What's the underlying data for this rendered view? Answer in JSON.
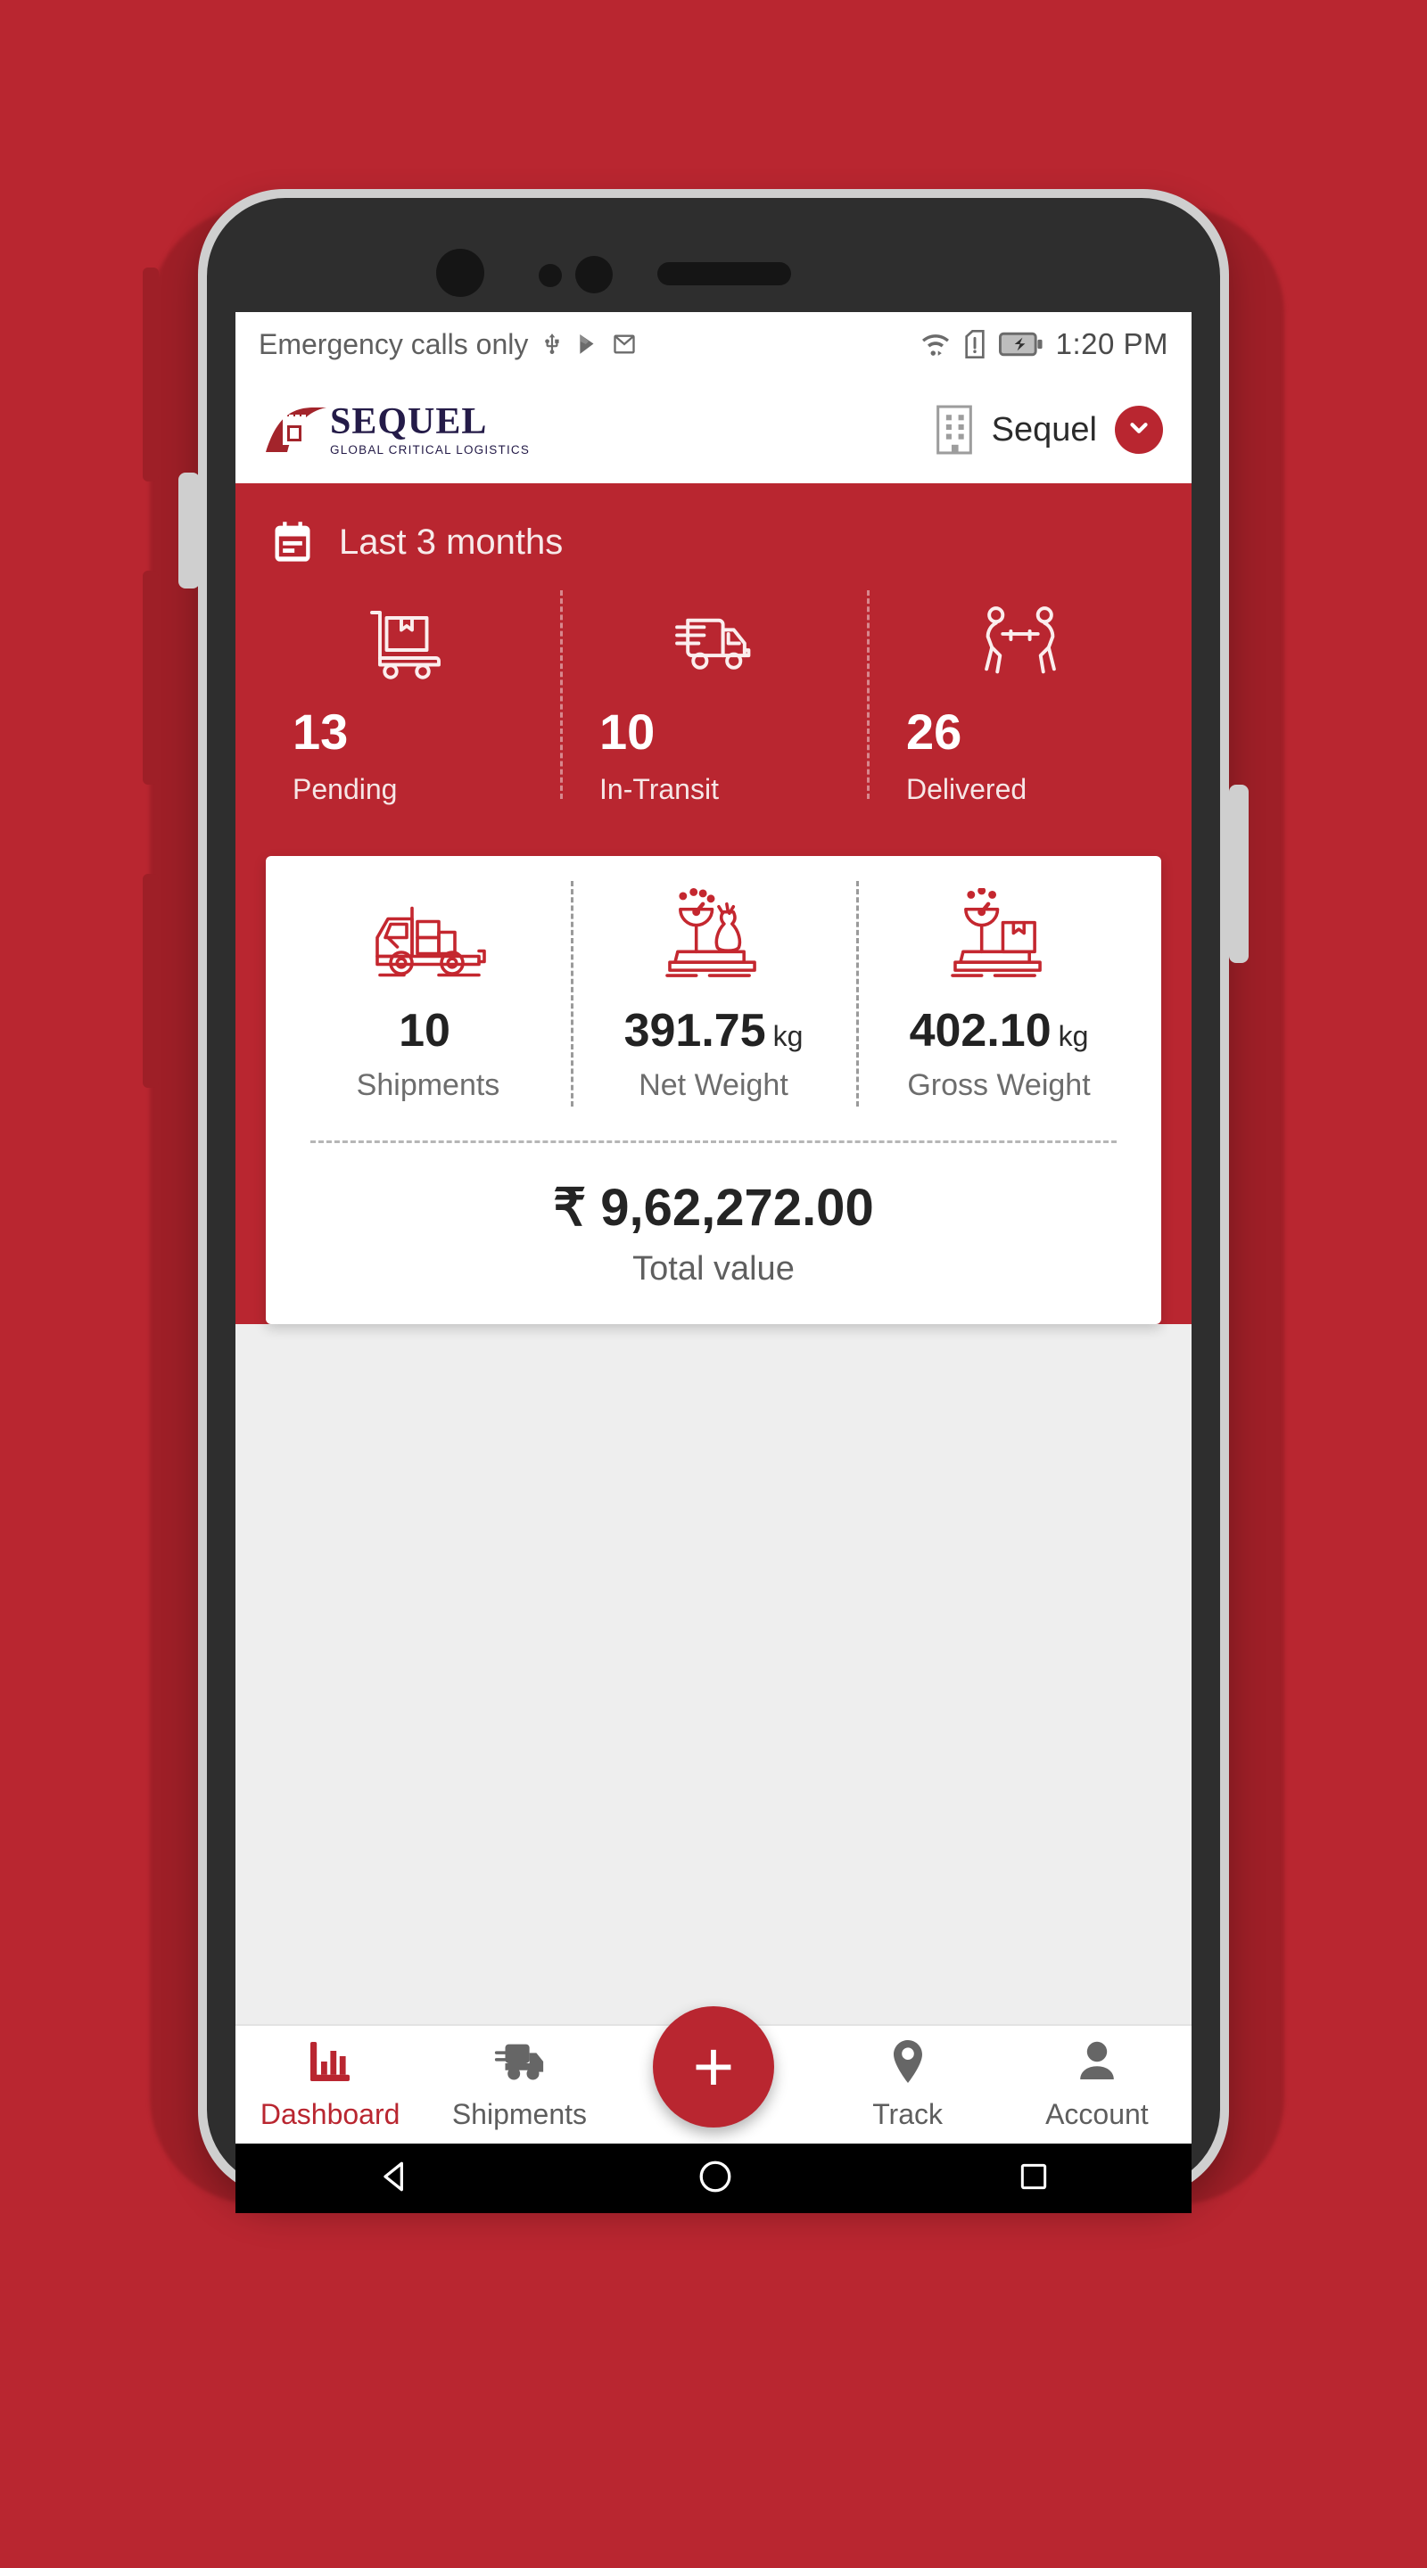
{
  "status_bar": {
    "carrier_text": "Emergency calls only",
    "time": "1:20 PM",
    "icons": [
      "usb-icon",
      "play-store-icon",
      "gmail-icon",
      "wifi-icon",
      "sim-alert-icon",
      "battery-charging-icon"
    ]
  },
  "app_header": {
    "logo_name": "SEQUEL",
    "logo_tagline": "GLOBAL CRITICAL LOGISTICS",
    "org_name": "Sequel",
    "org_icon": "building-icon",
    "dropdown_icon": "chevron-down-icon"
  },
  "period_filter": {
    "icon": "calendar-icon",
    "label": "Last 3 months"
  },
  "shipment_status": [
    {
      "icon": "hand-truck-box-icon",
      "value": "13",
      "label": "Pending"
    },
    {
      "icon": "delivery-van-icon",
      "value": "10",
      "label": "In-Transit"
    },
    {
      "icon": "porters-carry-icon",
      "value": "26",
      "label": "Delivered"
    }
  ],
  "summary_card": {
    "metrics": [
      {
        "icon": "loaded-truck-icon",
        "value": "10",
        "unit": "",
        "label": "Shipments"
      },
      {
        "icon": "scale-bag-icon",
        "value": "391.75",
        "unit": "kg",
        "label": "Net Weight"
      },
      {
        "icon": "scale-box-icon",
        "value": "402.10",
        "unit": "kg",
        "label": "Gross Weight"
      }
    ],
    "total_value": "₹ 9,62,272.00",
    "total_label": "Total value"
  },
  "bottom_nav": {
    "items": [
      {
        "icon": "bar-chart-icon",
        "label": "Dashboard",
        "active": true
      },
      {
        "icon": "truck-icon",
        "label": "Shipments",
        "active": false
      },
      {
        "icon": "map-pin-icon",
        "label": "Track",
        "active": false
      },
      {
        "icon": "person-icon",
        "label": "Account",
        "active": false
      }
    ],
    "fab_icon": "plus-icon",
    "fab_label": "+"
  },
  "android_nav": {
    "back": "back-triangle-icon",
    "home": "home-circle-icon",
    "recents": "recents-square-icon"
  },
  "colors": {
    "brand_red": "#b92630",
    "page_bg": "#b92630",
    "card_bg": "#ffffff",
    "screen_bg": "#eeeeee",
    "logo_navy": "#241b48"
  }
}
